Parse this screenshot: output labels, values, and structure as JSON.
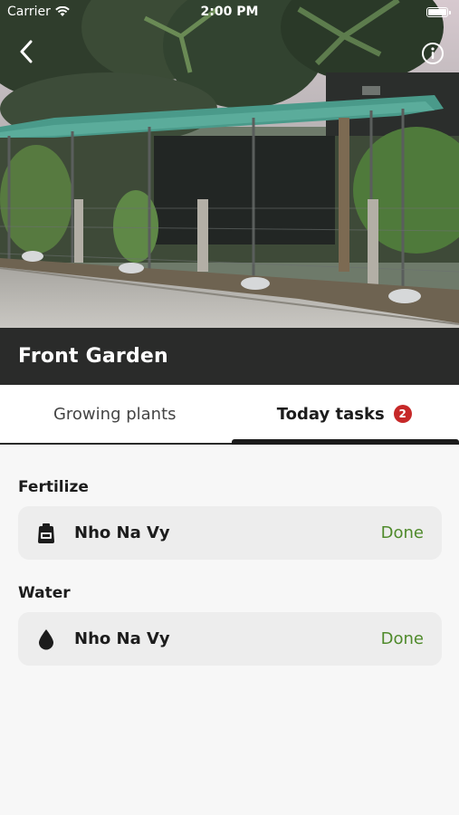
{
  "colors": {
    "title_bar": "#2a2b2a",
    "done": "#4f8a2b",
    "badge": "#c62828",
    "card": "#ededed"
  },
  "status_bar": {
    "carrier": "Carrier",
    "time": "2:00 PM",
    "icons": [
      "wifi-icon",
      "battery-icon"
    ]
  },
  "header": {
    "back_icon": "chevron-left-icon",
    "info_icon": "info-icon"
  },
  "garden": {
    "title": "Front Garden"
  },
  "tabs": [
    {
      "label": "Growing plants",
      "selected": false
    },
    {
      "label": "Today tasks",
      "selected": true,
      "badge": "2"
    }
  ],
  "tasks": [
    {
      "section": "Fertilize",
      "icon": "fertilizer-jug-icon",
      "plant": "Nho Na Vy",
      "action": "Done"
    },
    {
      "section": "Water",
      "icon": "water-drop-icon",
      "plant": "Nho Na Vy",
      "action": "Done"
    }
  ]
}
